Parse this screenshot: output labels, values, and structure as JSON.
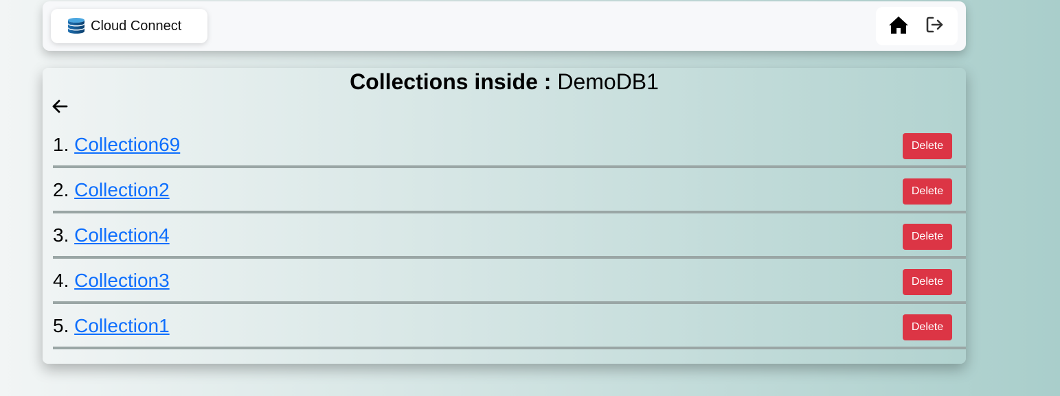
{
  "navbar": {
    "brand_name": "Cloud Connect",
    "brand_icon": "database-icon",
    "home_icon": "home-icon",
    "logout_icon": "logout-icon"
  },
  "page": {
    "title_label": "Collections inside :",
    "database_name": "DemoDB1",
    "back_icon": "arrow-left-icon"
  },
  "collections": [
    {
      "number": "1.",
      "name": "Collection69",
      "delete_label": "Delete"
    },
    {
      "number": "2.",
      "name": "Collection2",
      "delete_label": "Delete"
    },
    {
      "number": "3.",
      "name": "Collection4",
      "delete_label": "Delete"
    },
    {
      "number": "4.",
      "name": "Collection3",
      "delete_label": "Delete"
    },
    {
      "number": "5.",
      "name": "Collection1",
      "delete_label": "Delete"
    }
  ],
  "colors": {
    "link": "#0d6efd",
    "delete": "#dc3545",
    "divider": "#9aa6a5"
  }
}
